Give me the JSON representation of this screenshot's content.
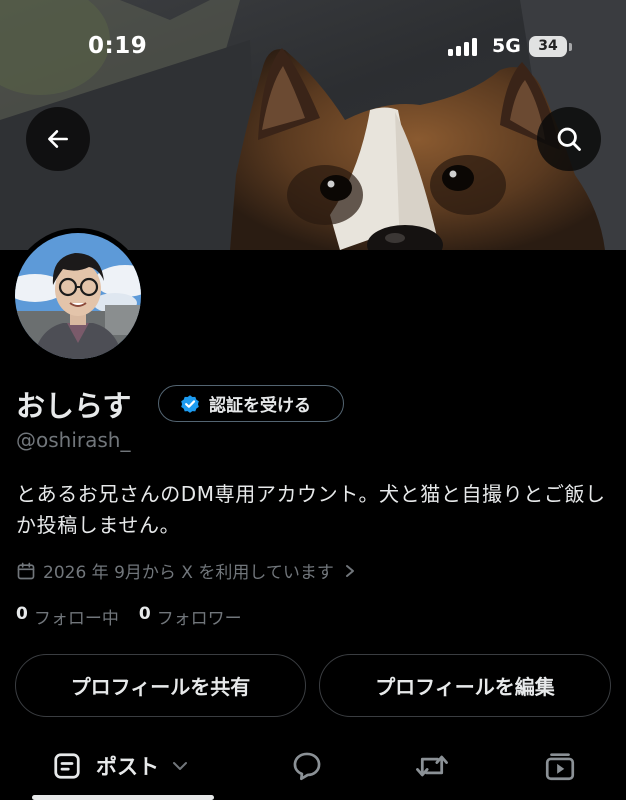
{
  "status_bar": {
    "time": "0:19",
    "network": "5G",
    "battery": "34",
    "signal_bars": 4
  },
  "header": {
    "back_icon": "arrow-left-icon",
    "search_icon": "search-icon"
  },
  "profile": {
    "display_name": "おしらす",
    "verify_label": "認証を受ける",
    "handle": "@oshirash_",
    "bio": "とあるお兄さんのDM専用アカウント。犬と猫と自撮りとご飯しか投稿しません。",
    "joined": "2026 年 9月から X を利用しています",
    "following_count": "0",
    "following_label": "フォロー中",
    "followers_count": "0",
    "followers_label": "フォロワー"
  },
  "actions": {
    "share_label": "プロフィールを共有",
    "edit_label": "プロフィールを編集"
  },
  "tabs": {
    "posts_label": "ポスト",
    "icons": [
      "posts-icon",
      "replies-icon",
      "reposts-icon",
      "videos-icon"
    ]
  },
  "colors": {
    "background": "#000000",
    "text_primary": "#e7e9ea",
    "text_secondary": "#71767b",
    "verified_blue": "#1d9bf0",
    "button_border": "#3a3d41"
  }
}
